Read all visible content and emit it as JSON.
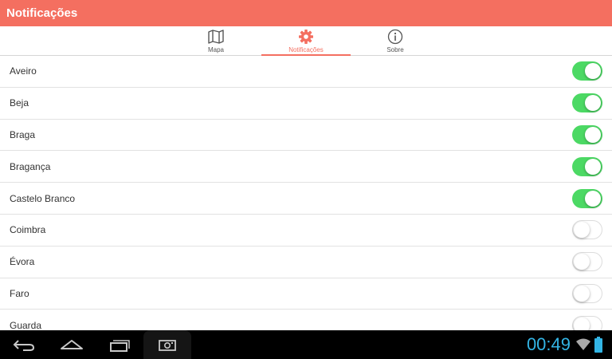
{
  "header": {
    "title": "Notificações"
  },
  "tabs": [
    {
      "label": "Mapa",
      "icon": "map-icon",
      "active": false
    },
    {
      "label": "Notificações",
      "icon": "gear-icon",
      "active": true
    },
    {
      "label": "Sobre",
      "icon": "info-icon",
      "active": false
    }
  ],
  "districts": [
    {
      "name": "Aveiro",
      "enabled": true
    },
    {
      "name": "Beja",
      "enabled": true
    },
    {
      "name": "Braga",
      "enabled": true
    },
    {
      "name": "Bragança",
      "enabled": true
    },
    {
      "name": "Castelo Branco",
      "enabled": true
    },
    {
      "name": "Coimbra",
      "enabled": false
    },
    {
      "name": "Évora",
      "enabled": false
    },
    {
      "name": "Faro",
      "enabled": false
    },
    {
      "name": "Guarda",
      "enabled": false
    }
  ],
  "statusbar": {
    "clock": "00:49"
  },
  "colors": {
    "accent": "#f46f60",
    "toggle_on": "#4cd964",
    "clock": "#33b5e5"
  }
}
